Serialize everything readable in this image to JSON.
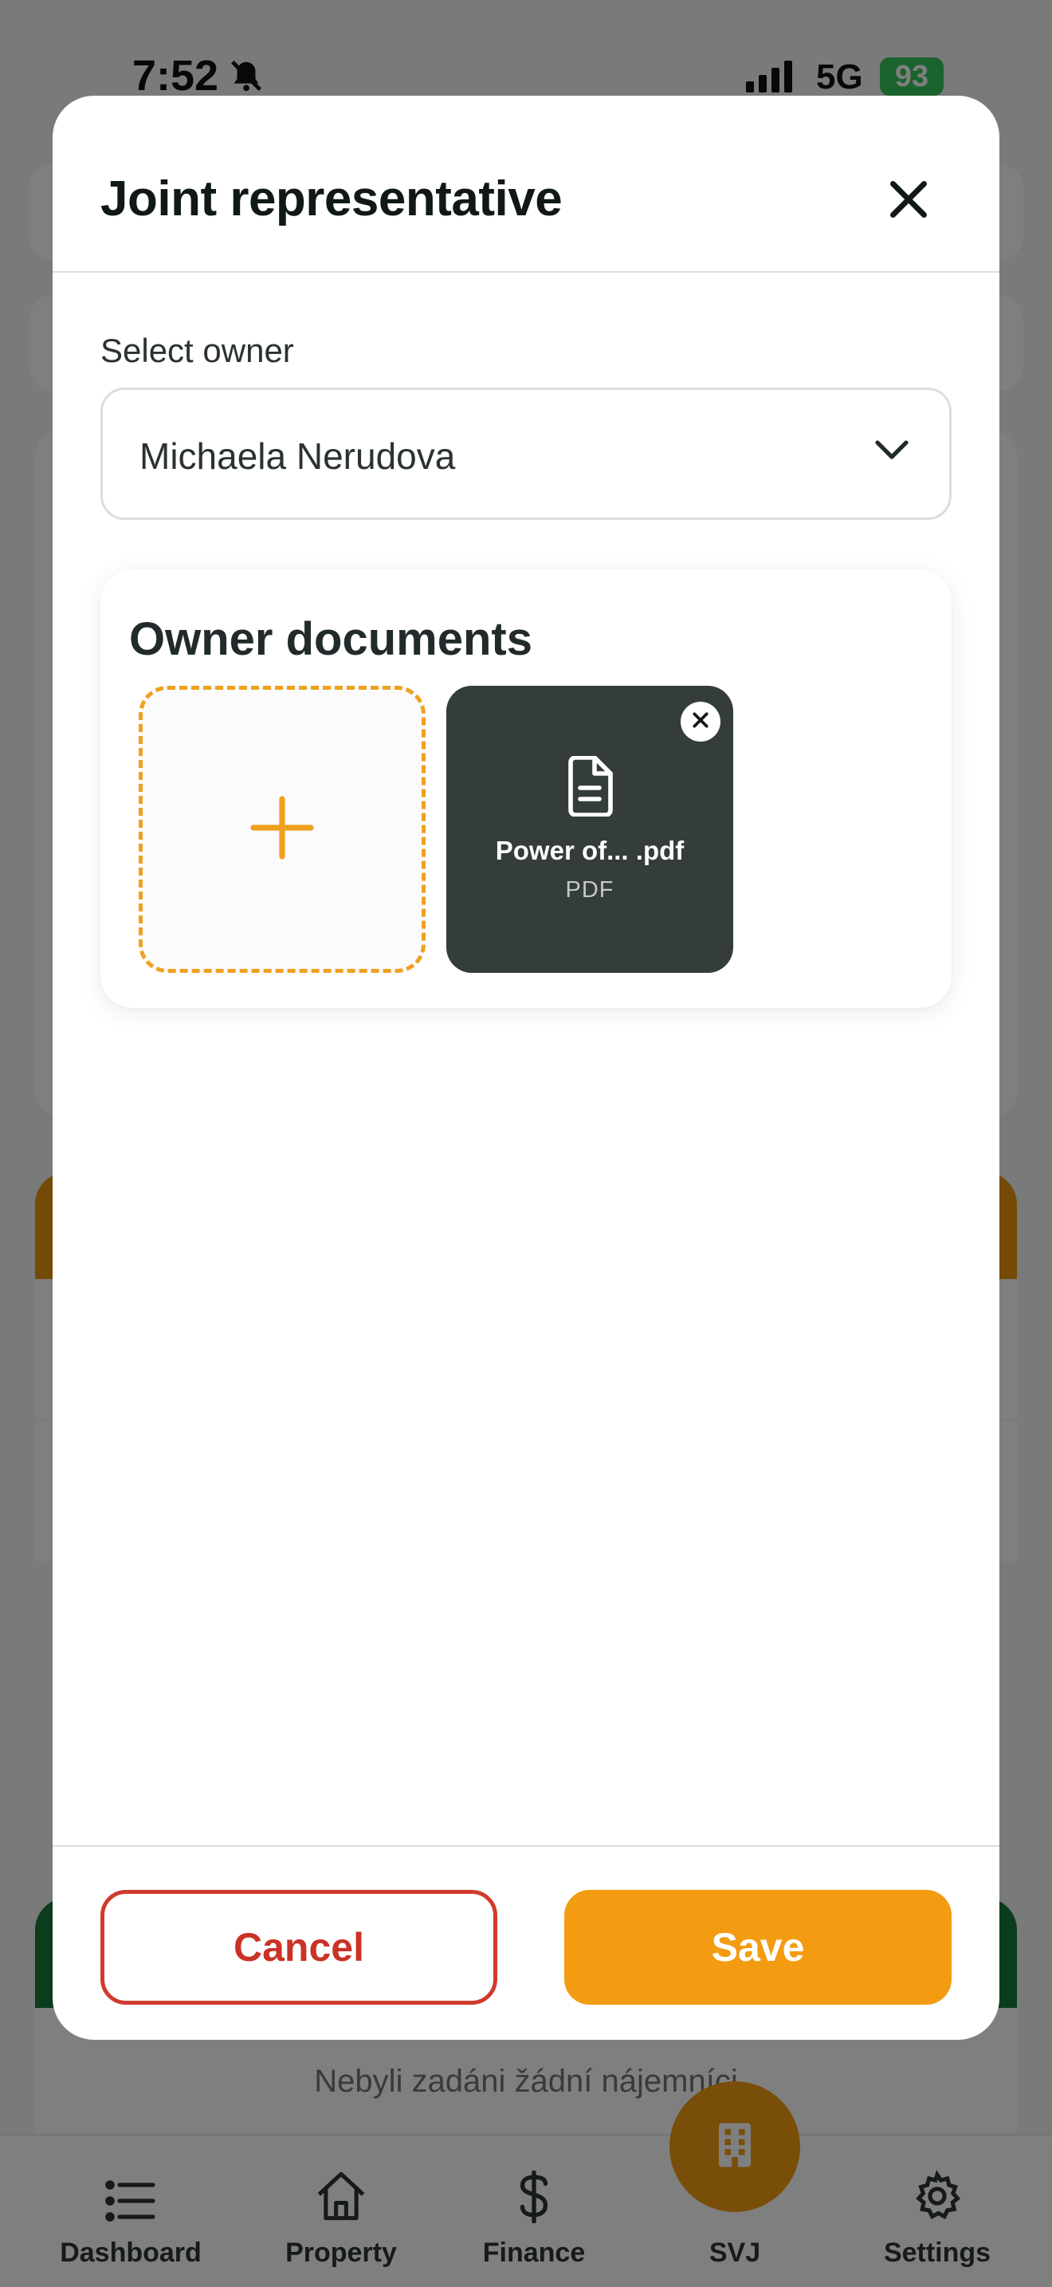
{
  "status_bar": {
    "time": "7:52",
    "network": "5G",
    "battery": "93"
  },
  "background": {
    "empty_message": "Nebyli zadáni žádní nájemníci",
    "tabs": [
      {
        "label": "Dashboard",
        "icon": "list-icon"
      },
      {
        "label": "Property",
        "icon": "house-icon"
      },
      {
        "label": "Finance",
        "icon": "dollar-icon"
      },
      {
        "label": "SVJ",
        "icon": "building-icon"
      },
      {
        "label": "Settings",
        "icon": "gear-icon"
      }
    ]
  },
  "modal": {
    "title": "Joint representative",
    "close_icon": "close-icon",
    "select_owner": {
      "label": "Select owner",
      "value": "Michaela Nerudova",
      "icon": "chevron-down-icon"
    },
    "documents": {
      "title": "Owner documents",
      "add_icon": "plus-icon",
      "files": [
        {
          "name": "Power of... .pdf",
          "type": "PDF",
          "icon": "document-icon"
        }
      ]
    },
    "footer": {
      "cancel_label": "Cancel",
      "save_label": "Save"
    }
  },
  "colors": {
    "accent": "#f39c12",
    "danger": "#d13a2e",
    "file_tile": "#343c3c",
    "battery": "#34c759"
  }
}
